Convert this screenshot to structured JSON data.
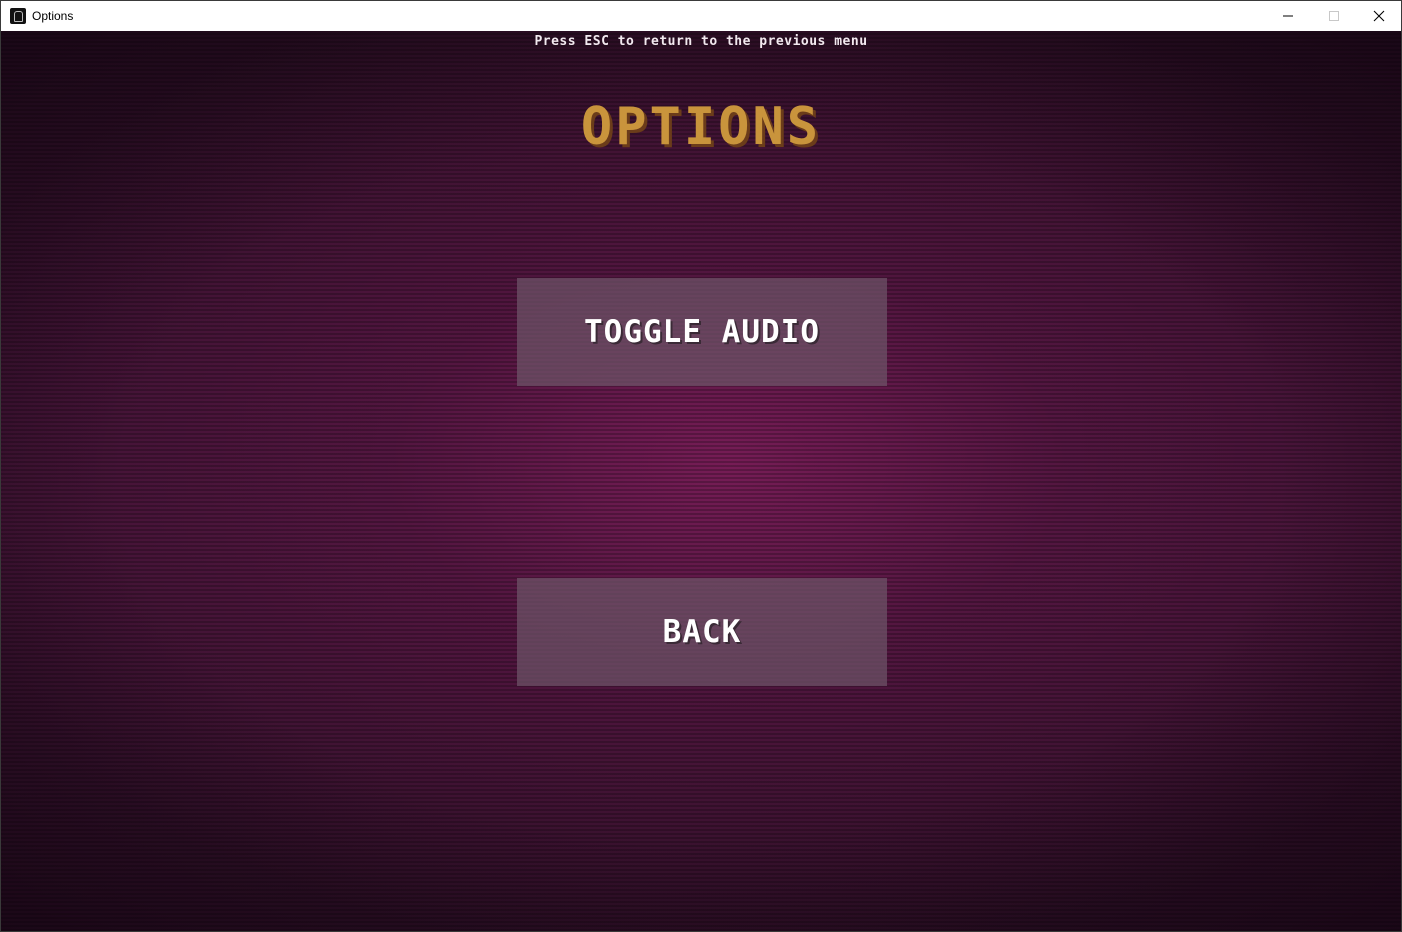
{
  "window": {
    "title": "Options",
    "icon": "app-icon",
    "controls": [
      "minimize-icon",
      "maximize-icon",
      "close-icon"
    ]
  },
  "screen": {
    "hint": "Press ESC to return to the previous menu",
    "heading": "OPTIONS",
    "buttons": {
      "toggle_audio": "TOGGLE AUDIO",
      "back": "BACK"
    }
  },
  "colors": {
    "heading": "#c9943c",
    "button_bg": "#6e5468",
    "button_text": "#ffffff",
    "background": "#3a1230"
  }
}
